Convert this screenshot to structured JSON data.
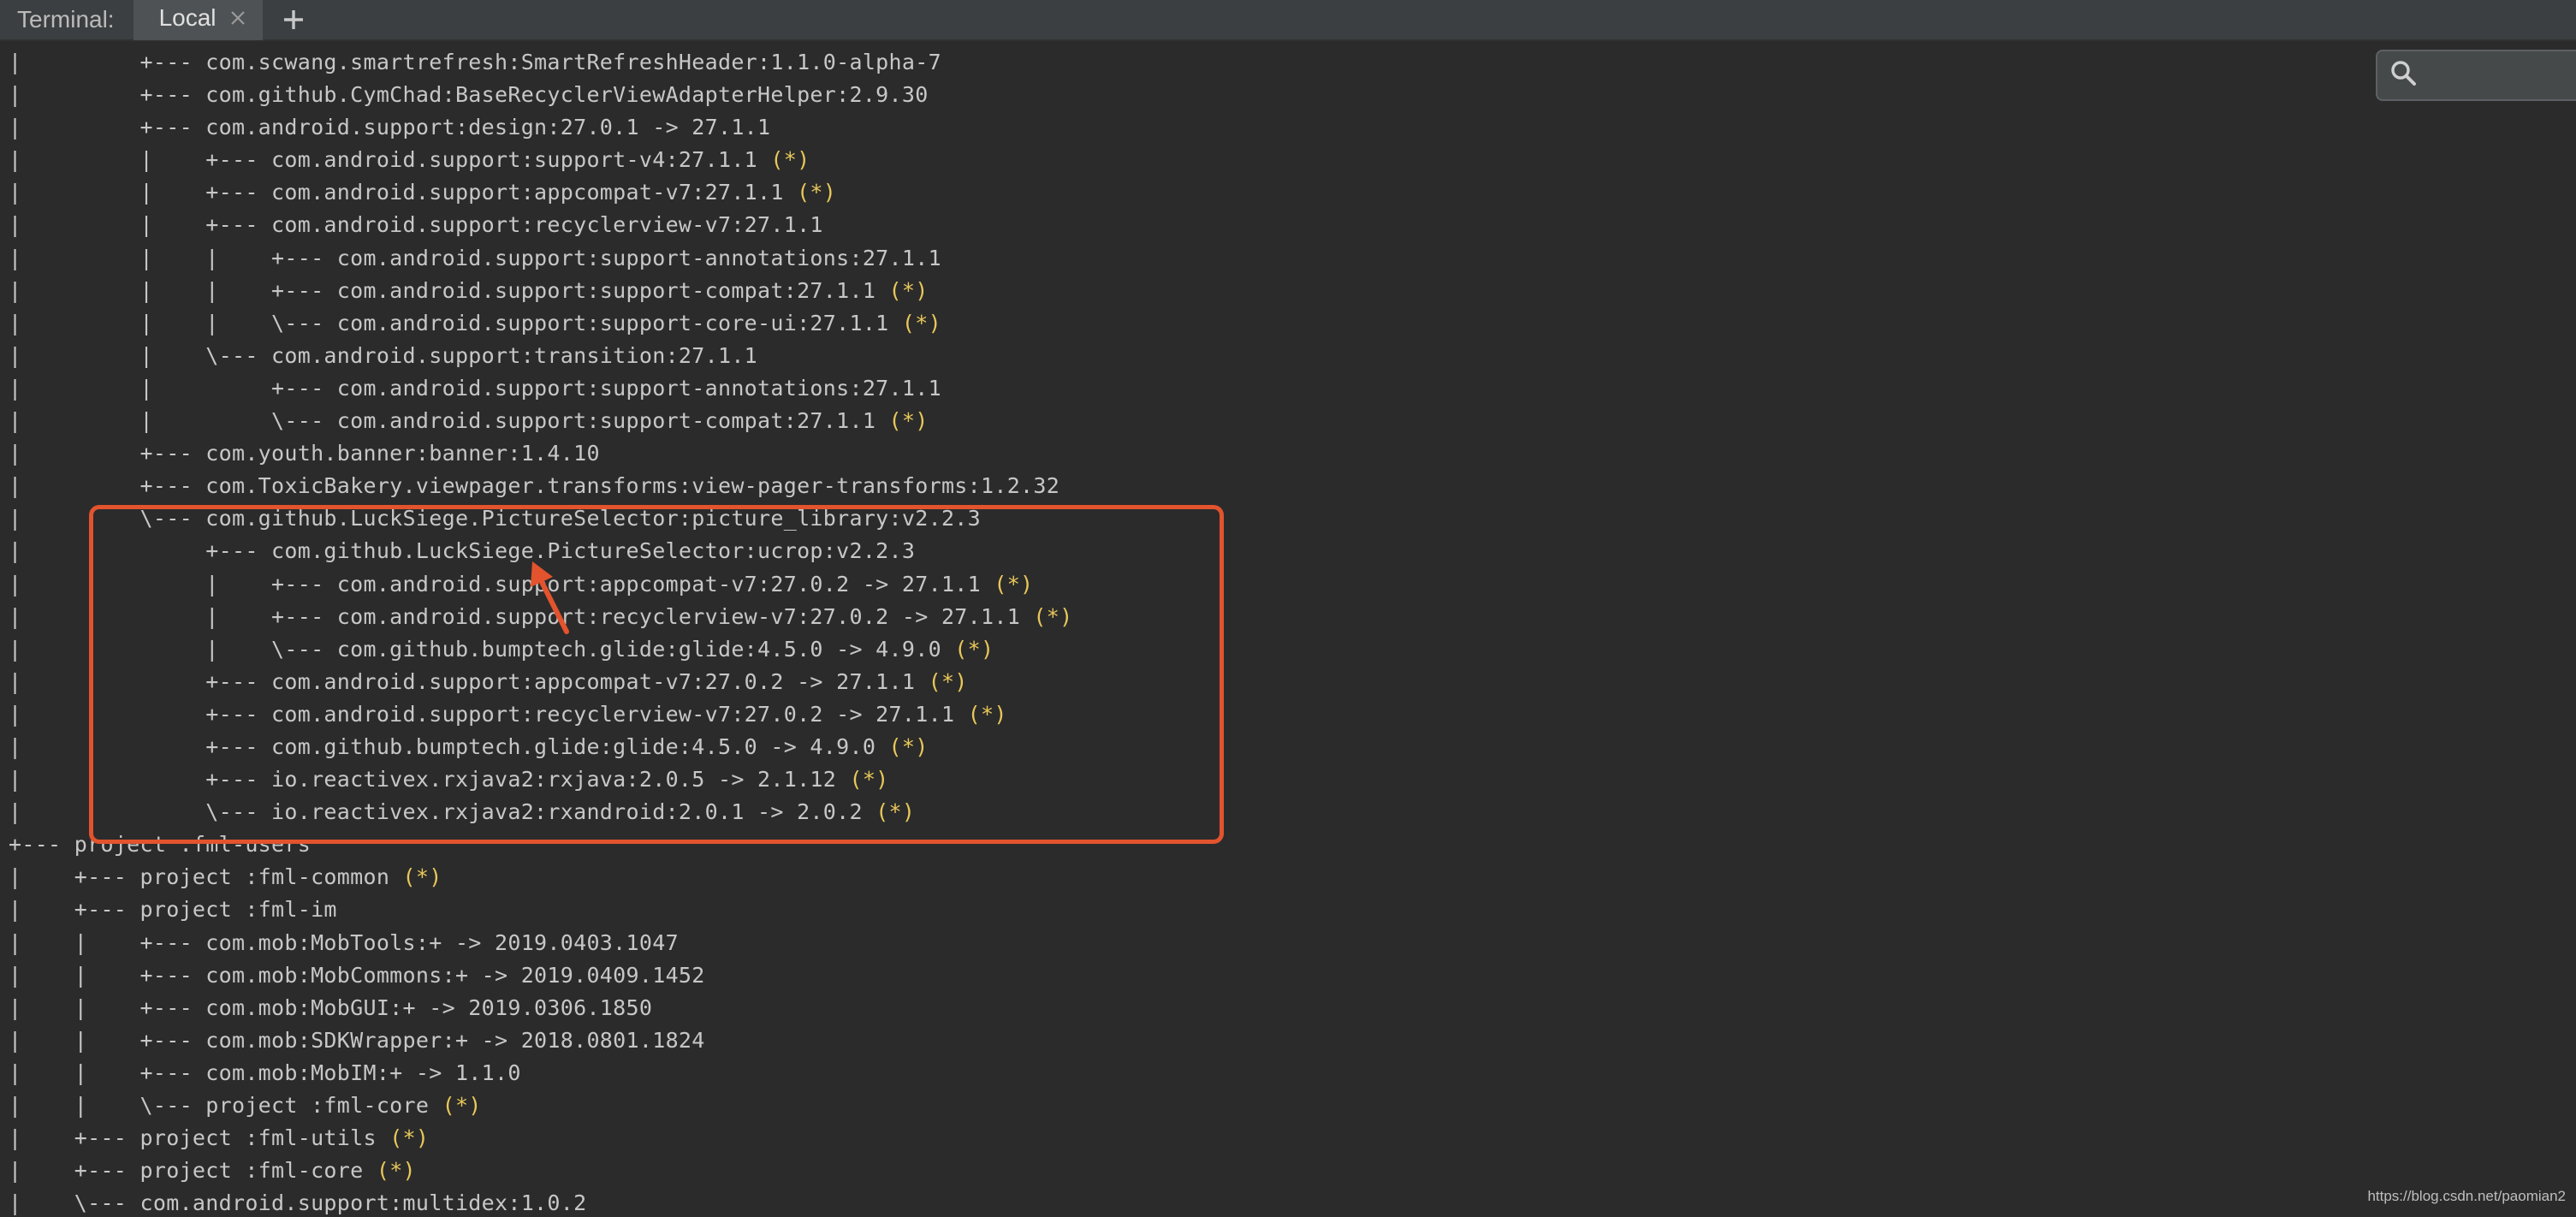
{
  "tabbar": {
    "label": "Terminal:",
    "tabs": [
      {
        "label": "Local",
        "close_icon": "close-icon"
      }
    ],
    "add_icon": "plus-icon"
  },
  "search": {
    "icon": "search-icon",
    "value": "",
    "placeholder": ""
  },
  "terminal": {
    "lines": [
      {
        "text": "|         +--- com.scwang.smartrefresh:SmartRefreshHeader:1.1.0-alpha-7",
        "star": ""
      },
      {
        "text": "|         +--- com.github.CymChad:BaseRecyclerViewAdapterHelper:2.9.30",
        "star": ""
      },
      {
        "text": "|         +--- com.android.support:design:27.0.1 -> 27.1.1",
        "star": ""
      },
      {
        "text": "|         |    +--- com.android.support:support-v4:27.1.1 ",
        "star": "(*)"
      },
      {
        "text": "|         |    +--- com.android.support:appcompat-v7:27.1.1 ",
        "star": "(*)"
      },
      {
        "text": "|         |    +--- com.android.support:recyclerview-v7:27.1.1",
        "star": ""
      },
      {
        "text": "|         |    |    +--- com.android.support:support-annotations:27.1.1",
        "star": ""
      },
      {
        "text": "|         |    |    +--- com.android.support:support-compat:27.1.1 ",
        "star": "(*)"
      },
      {
        "text": "|         |    |    \\--- com.android.support:support-core-ui:27.1.1 ",
        "star": "(*)"
      },
      {
        "text": "|         |    \\--- com.android.support:transition:27.1.1",
        "star": ""
      },
      {
        "text": "|         |         +--- com.android.support:support-annotations:27.1.1",
        "star": ""
      },
      {
        "text": "|         |         \\--- com.android.support:support-compat:27.1.1 ",
        "star": "(*)"
      },
      {
        "text": "|         +--- com.youth.banner:banner:1.4.10",
        "star": ""
      },
      {
        "text": "|         +--- com.ToxicBakery.viewpager.transforms:view-pager-transforms:1.2.32",
        "star": ""
      },
      {
        "text": "|         \\--- com.github.LuckSiege.PictureSelector:picture_library:v2.2.3",
        "star": ""
      },
      {
        "text": "|              +--- com.github.LuckSiege.PictureSelector:ucrop:v2.2.3",
        "star": ""
      },
      {
        "text": "|              |    +--- com.android.support:appcompat-v7:27.0.2 -> 27.1.1 ",
        "star": "(*)"
      },
      {
        "text": "|              |    +--- com.android.support:recyclerview-v7:27.0.2 -> 27.1.1 ",
        "star": "(*)"
      },
      {
        "text": "|              |    \\--- com.github.bumptech.glide:glide:4.5.0 -> 4.9.0 ",
        "star": "(*)"
      },
      {
        "text": "|              +--- com.android.support:appcompat-v7:27.0.2 -> 27.1.1 ",
        "star": "(*)"
      },
      {
        "text": "|              +--- com.android.support:recyclerview-v7:27.0.2 -> 27.1.1 ",
        "star": "(*)"
      },
      {
        "text": "|              +--- com.github.bumptech.glide:glide:4.5.0 -> 4.9.0 ",
        "star": "(*)"
      },
      {
        "text": "|              +--- io.reactivex.rxjava2:rxjava:2.0.5 -> 2.1.12 ",
        "star": "(*)"
      },
      {
        "text": "|              \\--- io.reactivex.rxjava2:rxandroid:2.0.1 -> 2.0.2 ",
        "star": "(*)"
      },
      {
        "text": "+--- project :fml-users",
        "star": ""
      },
      {
        "text": "|    +--- project :fml-common ",
        "star": "(*)"
      },
      {
        "text": "|    +--- project :fml-im",
        "star": ""
      },
      {
        "text": "|    |    +--- com.mob:MobTools:+ -> 2019.0403.1047",
        "star": ""
      },
      {
        "text": "|    |    +--- com.mob:MobCommons:+ -> 2019.0409.1452",
        "star": ""
      },
      {
        "text": "|    |    +--- com.mob:MobGUI:+ -> 2019.0306.1850",
        "star": ""
      },
      {
        "text": "|    |    +--- com.mob:SDKWrapper:+ -> 2018.0801.1824",
        "star": ""
      },
      {
        "text": "|    |    +--- com.mob:MobIM:+ -> 1.1.0",
        "star": ""
      },
      {
        "text": "|    |    \\--- project :fml-core ",
        "star": "(*)"
      },
      {
        "text": "|    +--- project :fml-utils ",
        "star": "(*)"
      },
      {
        "text": "|    +--- project :fml-core ",
        "star": "(*)"
      },
      {
        "text": "|    \\--- com.android.support:multidex:1.0.2",
        "star": ""
      }
    ]
  },
  "annotation": {
    "box_color": "#e2532e",
    "arrow_color": "#e2532e"
  },
  "watermark": "https://blog.csdn.net/paomian2",
  "colors": {
    "background": "#2b2b2b",
    "text": "#c7c7c7",
    "star": "#e8c75a"
  }
}
